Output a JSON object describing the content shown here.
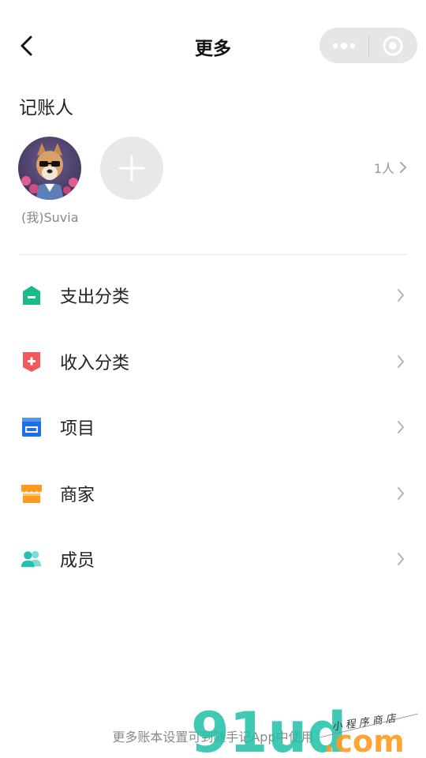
{
  "header": {
    "title": "更多"
  },
  "bookkeepers": {
    "section_title": "记账人",
    "me_name": "(我)Suvia",
    "count": "1人"
  },
  "menu": {
    "items": [
      {
        "label": "支出分类",
        "icon": "expense-category-icon",
        "color": "#1bbc8a"
      },
      {
        "label": "收入分类",
        "icon": "income-category-icon",
        "color": "#f05a5a"
      },
      {
        "label": "项目",
        "icon": "project-icon",
        "color": "#1e6fe8"
      },
      {
        "label": "商家",
        "icon": "merchant-icon",
        "color": "#ff9a1f"
      },
      {
        "label": "成员",
        "icon": "members-icon",
        "color": "#22c1b3"
      }
    ]
  },
  "footer": {
    "text": "更多账本设置可到随手记App中使用"
  },
  "watermark": {
    "brand": "91ud",
    "domain": ".com",
    "tagline": "小 程 序 商 店"
  }
}
